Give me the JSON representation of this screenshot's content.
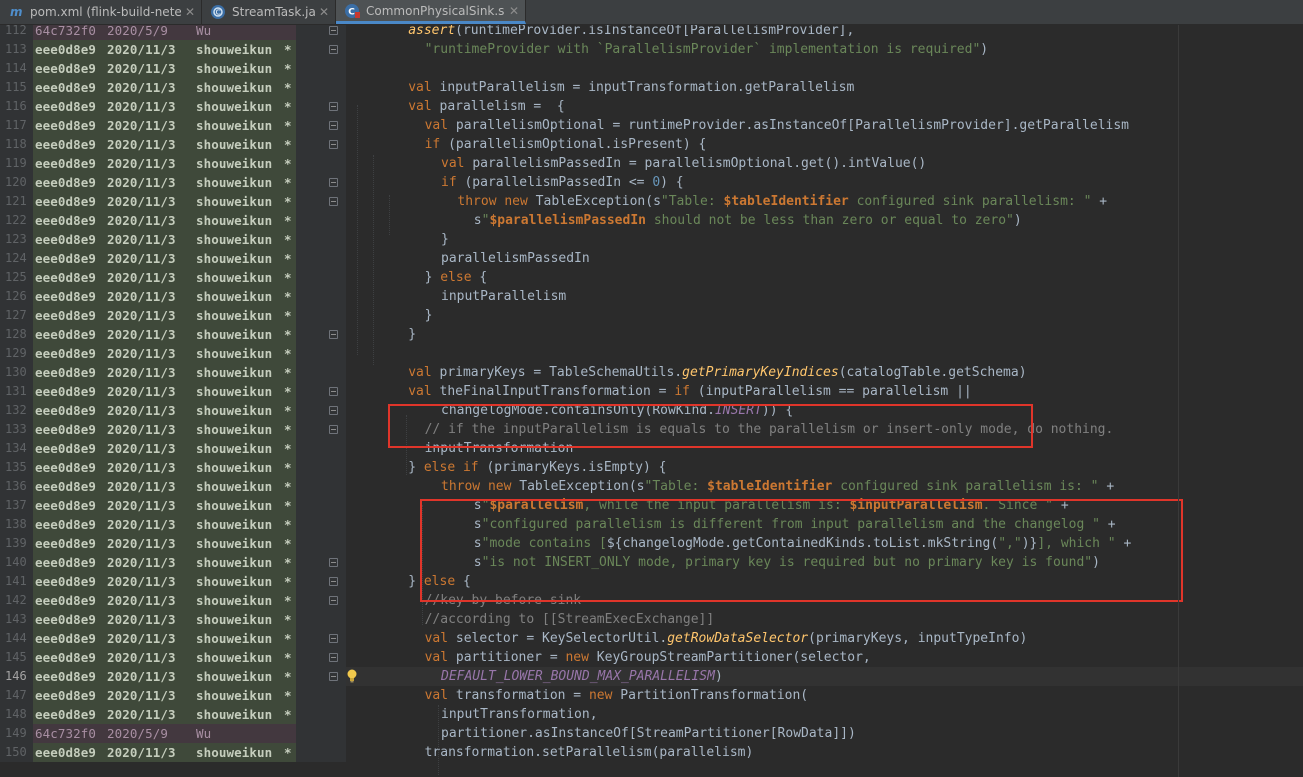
{
  "tabs": [
    {
      "label": "pom.xml (flink-build-netease",
      "icon": "maven-m-icon",
      "active": false
    },
    {
      "label": "StreamTask.java",
      "icon": "java-class-icon",
      "active": false
    },
    {
      "label": "CommonPhysicalSink.scala",
      "icon": "scala-class-icon",
      "active": true
    }
  ],
  "caret_line": 146,
  "colors": {
    "keyword": "#cc7832",
    "string": "#6a8759",
    "number": "#6897bb",
    "comment": "#808080",
    "italic_method": "#ffc66d",
    "constant": "#9876aa",
    "plain": "#a9b7c6",
    "highlight_box": "#e0352a",
    "blame_new_bg": "#3f493a",
    "blame_old_bg": "#43383f"
  },
  "lines": [
    {
      "n": 112,
      "hash": "64c732f0",
      "date": "2020/5/9",
      "author": "Wu",
      "star": "",
      "indent": 8,
      "t": [
        [
          "i",
          "assert"
        ],
        [
          "p",
          "(runtimeProvider.isInstanceOf[ParallelismProvider],"
        ]
      ]
    },
    {
      "n": 113,
      "hash": "eee0d8e9",
      "date": "2020/11/3",
      "author": "shouweikun",
      "star": "*",
      "indent": 9,
      "t": [
        [
          "s",
          "\"runtimeProvider with `ParallelismProvider` implementation is required\""
        ],
        [
          "p",
          ")"
        ]
      ]
    },
    {
      "n": 114,
      "hash": "eee0d8e9",
      "date": "2020/11/3",
      "author": "shouweikun",
      "star": "*",
      "indent": 0,
      "t": []
    },
    {
      "n": 115,
      "hash": "eee0d8e9",
      "date": "2020/11/3",
      "author": "shouweikun",
      "star": "*",
      "indent": 8,
      "t": [
        [
          "k",
          "val "
        ],
        [
          "p",
          "inputParallelism = inputTransformation.getParallelism"
        ]
      ]
    },
    {
      "n": 116,
      "hash": "eee0d8e9",
      "date": "2020/11/3",
      "author": "shouweikun",
      "star": "*",
      "indent": 8,
      "t": [
        [
          "k",
          "val "
        ],
        [
          "p",
          "parallelism =  {"
        ]
      ]
    },
    {
      "n": 117,
      "hash": "eee0d8e9",
      "date": "2020/11/3",
      "author": "shouweikun",
      "star": "*",
      "indent": 9,
      "t": [
        [
          "k",
          "val "
        ],
        [
          "p",
          "parallelismOptional = runtimeProvider.asInstanceOf[ParallelismProvider].getParallelism"
        ]
      ]
    },
    {
      "n": 118,
      "hash": "eee0d8e9",
      "date": "2020/11/3",
      "author": "shouweikun",
      "star": "*",
      "indent": 9,
      "t": [
        [
          "k",
          "if "
        ],
        [
          "p",
          "(parallelismOptional.isPresent) {"
        ]
      ]
    },
    {
      "n": 119,
      "hash": "eee0d8e9",
      "date": "2020/11/3",
      "author": "shouweikun",
      "star": "*",
      "indent": 10,
      "t": [
        [
          "k",
          "val "
        ],
        [
          "p",
          "parallelismPassedIn = parallelismOptional.get().intValue()"
        ]
      ]
    },
    {
      "n": 120,
      "hash": "eee0d8e9",
      "date": "2020/11/3",
      "author": "shouweikun",
      "star": "*",
      "indent": 10,
      "t": [
        [
          "k",
          "if "
        ],
        [
          "p",
          "(parallelismPassedIn <= "
        ],
        [
          "n",
          "0"
        ],
        [
          "p",
          ") {"
        ]
      ]
    },
    {
      "n": 121,
      "hash": "eee0d8e9",
      "date": "2020/11/3",
      "author": "shouweikun",
      "star": "*",
      "indent": 11,
      "t": [
        [
          "k",
          "throw new "
        ],
        [
          "p",
          "TableException(s"
        ],
        [
          "s",
          "\"Table: "
        ],
        [
          "b",
          "$tableIdentifier"
        ],
        [
          "s",
          " configured sink parallelism: \" "
        ],
        [
          "p",
          "+"
        ]
      ]
    },
    {
      "n": 122,
      "hash": "eee0d8e9",
      "date": "2020/11/3",
      "author": "shouweikun",
      "star": "*",
      "indent": 12,
      "t": [
        [
          "p",
          "s"
        ],
        [
          "s",
          "\""
        ],
        [
          "b",
          "$parallelismPassedIn"
        ],
        [
          "s",
          " should not be less than zero or equal to zero\""
        ],
        [
          "p",
          ")"
        ]
      ]
    },
    {
      "n": 123,
      "hash": "eee0d8e9",
      "date": "2020/11/3",
      "author": "shouweikun",
      "star": "*",
      "indent": 10,
      "t": [
        [
          "p",
          "}"
        ]
      ]
    },
    {
      "n": 124,
      "hash": "eee0d8e9",
      "date": "2020/11/3",
      "author": "shouweikun",
      "star": "*",
      "indent": 10,
      "t": [
        [
          "p",
          "parallelismPassedIn"
        ]
      ]
    },
    {
      "n": 125,
      "hash": "eee0d8e9",
      "date": "2020/11/3",
      "author": "shouweikun",
      "star": "*",
      "indent": 9,
      "t": [
        [
          "p",
          "} "
        ],
        [
          "k",
          "else "
        ],
        [
          "p",
          "{"
        ]
      ]
    },
    {
      "n": 126,
      "hash": "eee0d8e9",
      "date": "2020/11/3",
      "author": "shouweikun",
      "star": "*",
      "indent": 10,
      "t": [
        [
          "p",
          "inputParallelism"
        ]
      ]
    },
    {
      "n": 127,
      "hash": "eee0d8e9",
      "date": "2020/11/3",
      "author": "shouweikun",
      "star": "*",
      "indent": 9,
      "t": [
        [
          "p",
          "}"
        ]
      ]
    },
    {
      "n": 128,
      "hash": "eee0d8e9",
      "date": "2020/11/3",
      "author": "shouweikun",
      "star": "*",
      "indent": 8,
      "t": [
        [
          "p",
          "}"
        ]
      ]
    },
    {
      "n": 129,
      "hash": "eee0d8e9",
      "date": "2020/11/3",
      "author": "shouweikun",
      "star": "*",
      "indent": 0,
      "t": []
    },
    {
      "n": 130,
      "hash": "eee0d8e9",
      "date": "2020/11/3",
      "author": "shouweikun",
      "star": "*",
      "indent": 8,
      "t": [
        [
          "k",
          "val "
        ],
        [
          "p",
          "primaryKeys = TableSchemaUtils."
        ],
        [
          "i",
          "getPrimaryKeyIndices"
        ],
        [
          "p",
          "(catalogTable.getSchema)"
        ]
      ]
    },
    {
      "n": 131,
      "hash": "eee0d8e9",
      "date": "2020/11/3",
      "author": "shouweikun",
      "star": "*",
      "indent": 8,
      "t": [
        [
          "k",
          "val "
        ],
        [
          "p",
          "theFinalInputTransformation = "
        ],
        [
          "k",
          "if "
        ],
        [
          "p",
          "(inputParallelism == parallelism ||"
        ]
      ]
    },
    {
      "n": 132,
      "hash": "eee0d8e9",
      "date": "2020/11/3",
      "author": "shouweikun",
      "star": "*",
      "indent": 10,
      "t": [
        [
          "p",
          "changelogMode.containsOnly(RowKind."
        ],
        [
          "c",
          "INSERT"
        ],
        [
          "p",
          ")) {"
        ]
      ]
    },
    {
      "n": 133,
      "hash": "eee0d8e9",
      "date": "2020/11/3",
      "author": "shouweikun",
      "star": "*",
      "indent": 9,
      "t": [
        [
          "m",
          "// if the inputParallelism is equals to the parallelism or insert-only mode, do nothing."
        ]
      ]
    },
    {
      "n": 134,
      "hash": "eee0d8e9",
      "date": "2020/11/3",
      "author": "shouweikun",
      "star": "*",
      "indent": 9,
      "t": [
        [
          "p",
          "inputTransformation"
        ]
      ]
    },
    {
      "n": 135,
      "hash": "eee0d8e9",
      "date": "2020/11/3",
      "author": "shouweikun",
      "star": "*",
      "indent": 8,
      "t": [
        [
          "p",
          "} "
        ],
        [
          "k",
          "else if "
        ],
        [
          "p",
          "(primaryKeys.isEmpty) {"
        ]
      ]
    },
    {
      "n": 136,
      "hash": "eee0d8e9",
      "date": "2020/11/3",
      "author": "shouweikun",
      "star": "*",
      "indent": 10,
      "t": [
        [
          "k",
          "throw new "
        ],
        [
          "p",
          "TableException(s"
        ],
        [
          "s",
          "\"Table: "
        ],
        [
          "b",
          "$tableIdentifier"
        ],
        [
          "s",
          " configured sink parallelism is: \" "
        ],
        [
          "p",
          "+"
        ]
      ]
    },
    {
      "n": 137,
      "hash": "eee0d8e9",
      "date": "2020/11/3",
      "author": "shouweikun",
      "star": "*",
      "indent": 12,
      "t": [
        [
          "p",
          "s"
        ],
        [
          "s",
          "\""
        ],
        [
          "b",
          "$parallelism"
        ],
        [
          "s",
          ", while the input parallelism is: "
        ],
        [
          "b",
          "$inputParallelism"
        ],
        [
          "s",
          ". Since \" "
        ],
        [
          "p",
          "+"
        ]
      ]
    },
    {
      "n": 138,
      "hash": "eee0d8e9",
      "date": "2020/11/3",
      "author": "shouweikun",
      "star": "*",
      "indent": 12,
      "t": [
        [
          "p",
          "s"
        ],
        [
          "s",
          "\"configured parallelism is different from input parallelism and the changelog \" "
        ],
        [
          "p",
          "+"
        ]
      ]
    },
    {
      "n": 139,
      "hash": "eee0d8e9",
      "date": "2020/11/3",
      "author": "shouweikun",
      "star": "*",
      "indent": 12,
      "t": [
        [
          "p",
          "s"
        ],
        [
          "s",
          "\"mode contains ["
        ],
        [
          "p",
          "${changelogMode.getContainedKinds.toList.mkString("
        ],
        [
          "s",
          "\",\""
        ],
        [
          "p",
          ")}"
        ],
        [
          "s",
          "], which \" "
        ],
        [
          "p",
          "+"
        ]
      ]
    },
    {
      "n": 140,
      "hash": "eee0d8e9",
      "date": "2020/11/3",
      "author": "shouweikun",
      "star": "*",
      "indent": 12,
      "t": [
        [
          "p",
          "s"
        ],
        [
          "s",
          "\"is not INSERT_ONLY mode, primary key is required but no primary key is found\""
        ],
        [
          "p",
          ")"
        ]
      ]
    },
    {
      "n": 141,
      "hash": "eee0d8e9",
      "date": "2020/11/3",
      "author": "shouweikun",
      "star": "*",
      "indent": 8,
      "t": [
        [
          "p",
          "} "
        ],
        [
          "k",
          "else "
        ],
        [
          "p",
          "{"
        ]
      ]
    },
    {
      "n": 142,
      "hash": "eee0d8e9",
      "date": "2020/11/3",
      "author": "shouweikun",
      "star": "*",
      "indent": 9,
      "t": [
        [
          "m",
          "//key by before sink"
        ]
      ]
    },
    {
      "n": 143,
      "hash": "eee0d8e9",
      "date": "2020/11/3",
      "author": "shouweikun",
      "star": "*",
      "indent": 9,
      "t": [
        [
          "m",
          "//according to [[StreamExecExchange]]"
        ]
      ]
    },
    {
      "n": 144,
      "hash": "eee0d8e9",
      "date": "2020/11/3",
      "author": "shouweikun",
      "star": "*",
      "indent": 9,
      "t": [
        [
          "k",
          "val "
        ],
        [
          "p",
          "selector = KeySelectorUtil."
        ],
        [
          "i",
          "getRowDataSelector"
        ],
        [
          "p",
          "(primaryKeys, inputTypeInfo)"
        ]
      ]
    },
    {
      "n": 145,
      "hash": "eee0d8e9",
      "date": "2020/11/3",
      "author": "shouweikun",
      "star": "*",
      "indent": 9,
      "t": [
        [
          "k",
          "val "
        ],
        [
          "p",
          "partitioner = "
        ],
        [
          "k",
          "new "
        ],
        [
          "p",
          "KeyGroupStreamPartitioner(selector,"
        ]
      ]
    },
    {
      "n": 146,
      "hash": "eee0d8e9",
      "date": "2020/11/3",
      "author": "shouweikun",
      "star": "*",
      "indent": 10,
      "t": [
        [
          "c",
          "DEFAULT_LOWER_BOUND_MAX_PARALLELISM"
        ],
        [
          "p",
          ")"
        ]
      ]
    },
    {
      "n": 147,
      "hash": "eee0d8e9",
      "date": "2020/11/3",
      "author": "shouweikun",
      "star": "*",
      "indent": 9,
      "t": [
        [
          "k",
          "val "
        ],
        [
          "p",
          "transformation = "
        ],
        [
          "k",
          "new "
        ],
        [
          "p",
          "PartitionTransformation("
        ]
      ]
    },
    {
      "n": 148,
      "hash": "eee0d8e9",
      "date": "2020/11/3",
      "author": "shouweikun",
      "star": "*",
      "indent": 10,
      "t": [
        [
          "p",
          "inputTransformation,"
        ]
      ]
    },
    {
      "n": 149,
      "hash": "64c732f0",
      "date": "2020/5/9",
      "author": "Wu",
      "star": "",
      "indent": 10,
      "t": [
        [
          "p",
          "partitioner.asInstanceOf[StreamPartitioner[RowData]])"
        ]
      ]
    },
    {
      "n": 150,
      "hash": "eee0d8e9",
      "date": "2020/11/3",
      "author": "shouweikun",
      "star": "*",
      "indent": 9,
      "t": [
        [
          "p",
          "transformation.setParallelism(parallelism)"
        ]
      ]
    }
  ]
}
